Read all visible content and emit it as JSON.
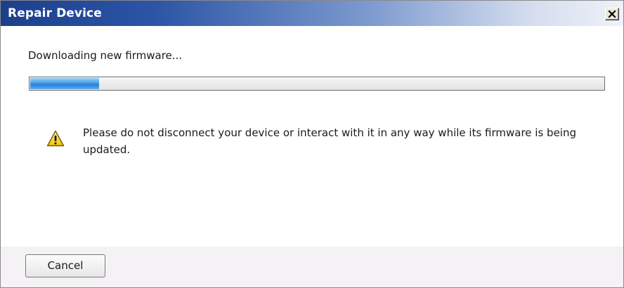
{
  "window": {
    "title": "Repair Device",
    "close_icon": "close-icon"
  },
  "main": {
    "status_text": "Downloading new firmware...",
    "progress_fraction": 0.12,
    "progress_color": "#2b7fd6",
    "warning_icon": "warning-icon",
    "warning_text": "Please do not disconnect your device or interact with it in any way while its firmware is being updated."
  },
  "footer": {
    "cancel_label": "Cancel"
  }
}
